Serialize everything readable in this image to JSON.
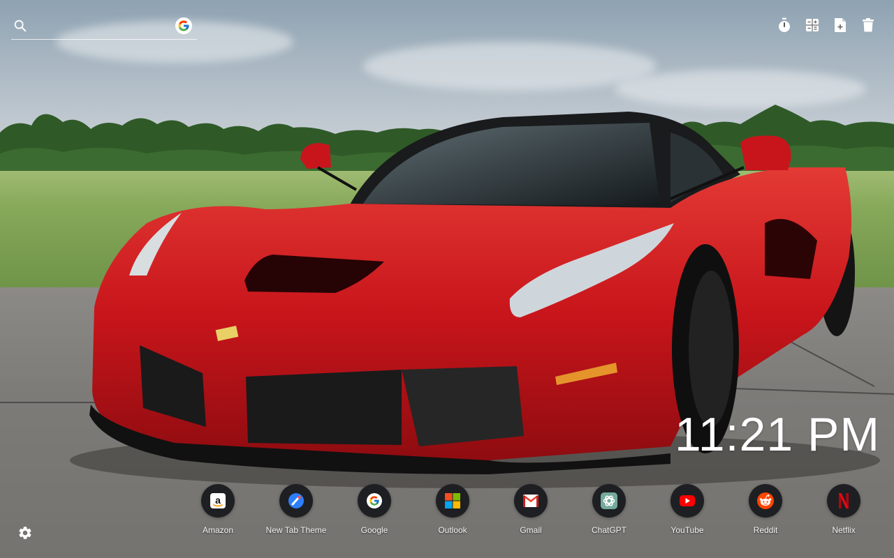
{
  "search": {
    "placeholder": "",
    "value": "",
    "icon": "search-icon",
    "engine_icon": "google-icon"
  },
  "toolbar": [
    {
      "name": "timer-icon"
    },
    {
      "name": "calculator-icon"
    },
    {
      "name": "document-icon"
    },
    {
      "name": "trash-icon"
    }
  ],
  "clock": {
    "time": "11:21 PM"
  },
  "shortcuts": [
    {
      "label": "Amazon",
      "icon": "amazon-icon"
    },
    {
      "label": "New Tab Theme",
      "icon": "new-tab-theme-icon"
    },
    {
      "label": "Google",
      "icon": "google-icon"
    },
    {
      "label": "Outlook",
      "icon": "outlook-icon"
    },
    {
      "label": "Gmail",
      "icon": "gmail-icon"
    },
    {
      "label": "ChatGPT",
      "icon": "chatgpt-icon"
    },
    {
      "label": "YouTube",
      "icon": "youtube-icon"
    },
    {
      "label": "Reddit",
      "icon": "reddit-icon"
    },
    {
      "label": "Netflix",
      "icon": "netflix-icon"
    }
  ],
  "settings": {
    "icon": "gear-icon"
  },
  "colors": {
    "car_red": "#c8151b",
    "dock_circle": "#1e1f22",
    "text": "#ffffff"
  }
}
